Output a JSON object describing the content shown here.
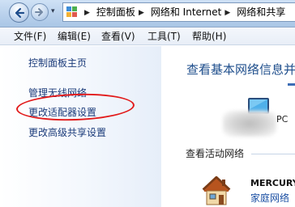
{
  "address": {
    "breadcrumbs": [
      "控制面板",
      "网络和 Internet",
      "网络和共享"
    ],
    "history_glyph": "▾",
    "separator_glyph": "▶"
  },
  "menu": {
    "items": [
      "文件(F)",
      "编辑(E)",
      "查看(V)",
      "工具(T)",
      "帮助(H)"
    ]
  },
  "sidebar": {
    "links": [
      "控制面板主页",
      "管理无线网络",
      "更改适配器设置",
      "更改高级共享设置"
    ]
  },
  "main": {
    "title": "查看基本网络信息并",
    "computer_label": "PC",
    "active_networks_title": "查看活动网络",
    "network_name": "MERCURY",
    "network_type": "家庭网络"
  },
  "colors": {
    "link": "#1b3b7a",
    "title": "#1e4e8c",
    "highlight": "#e21a1a",
    "network_type": "#1b4fa3"
  },
  "icons": {
    "back": "back-arrow-icon",
    "forward": "forward-arrow-icon",
    "control_panel": "control-panel-icon",
    "computer": "computer-icon",
    "home_network": "home-network-icon"
  }
}
